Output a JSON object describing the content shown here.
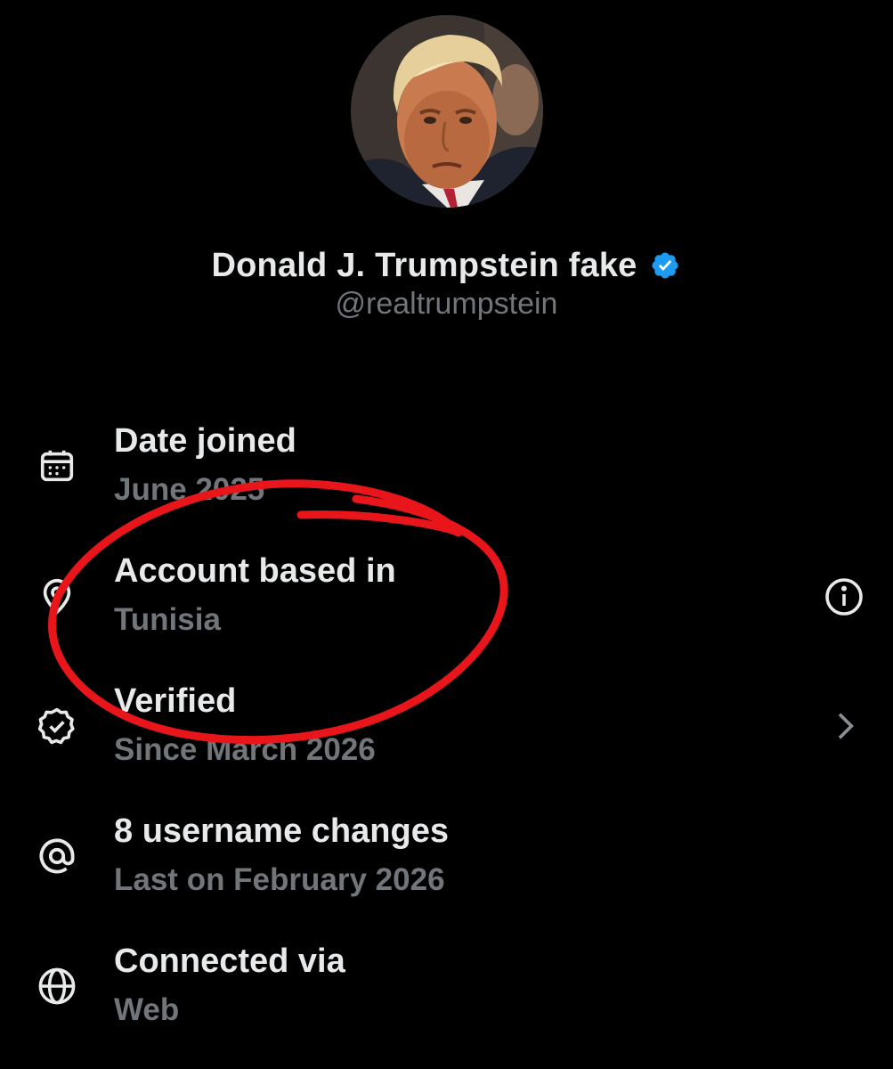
{
  "profile": {
    "display_name": "Donald J. Trumpstein fake",
    "handle": "@realtrumpstein",
    "verified_badge_icon": "verified-badge-icon",
    "badge_color": "#1d9bf0"
  },
  "details": [
    {
      "icon": "calendar-icon",
      "title": "Date joined",
      "subtitle": "June 2025"
    },
    {
      "icon": "location-pin-icon",
      "title": "Account based in",
      "subtitle": "Tunisia",
      "trailing_icon": "info-icon"
    },
    {
      "icon": "verified-seal-icon",
      "title": "Verified",
      "subtitle": "Since March 2026",
      "trailing_icon": "chevron-right-icon"
    },
    {
      "icon": "at-sign-icon",
      "title": "8 username changes",
      "subtitle": "Last on February 2026"
    },
    {
      "icon": "globe-icon",
      "title": "Connected via",
      "subtitle": "Web"
    }
  ],
  "colors": {
    "background": "#000000",
    "primary_text": "#e7e9ea",
    "secondary_text": "#71767b",
    "annotation": "#e8161b"
  }
}
